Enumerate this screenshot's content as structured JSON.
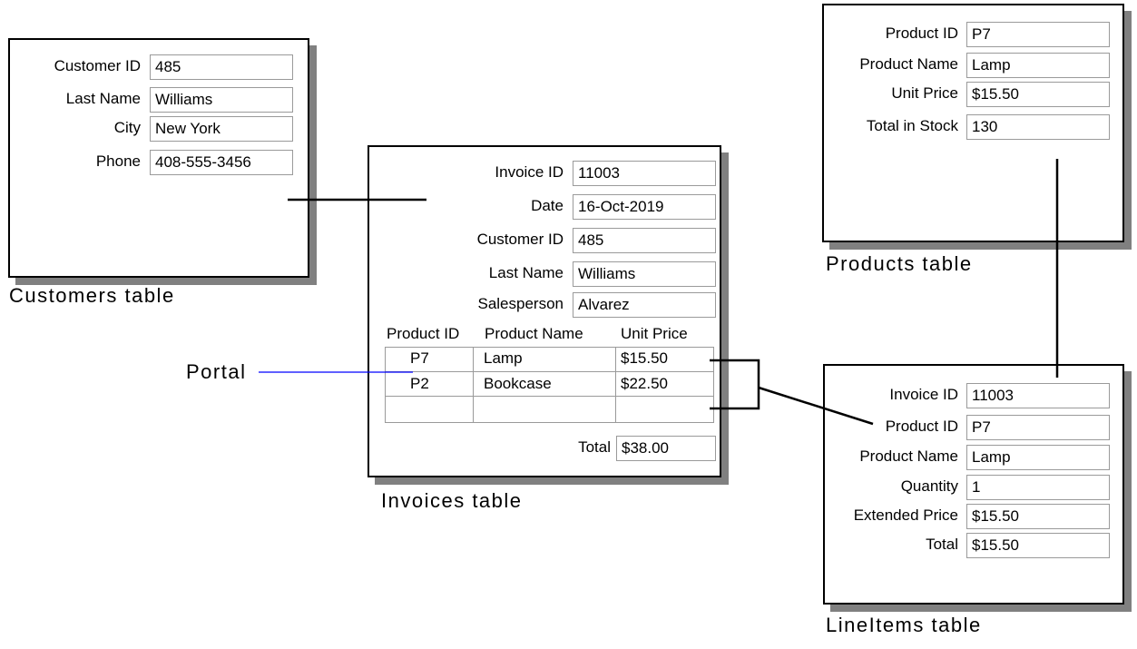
{
  "customers": {
    "caption": "Customers table",
    "fields": [
      {
        "label": "Customer ID",
        "value": "485"
      },
      {
        "label": "Last Name",
        "value": "Williams"
      },
      {
        "label": "City",
        "value": "New York"
      },
      {
        "label": "Phone",
        "value": "408-555-3456"
      }
    ]
  },
  "invoices": {
    "caption": "Invoices table",
    "fields": [
      {
        "label": "Invoice ID",
        "value": "11003"
      },
      {
        "label": "Date",
        "value": "16-Oct-2019"
      },
      {
        "label": "Customer ID",
        "value": "485"
      },
      {
        "label": "Last Name",
        "value": "Williams"
      },
      {
        "label": "Salesperson",
        "value": "Alvarez"
      }
    ],
    "portal": {
      "label": "Portal",
      "columns": [
        "Product ID",
        "Product Name",
        "Unit Price"
      ],
      "rows": [
        [
          "P7",
          "Lamp",
          "$15.50"
        ],
        [
          "P2",
          "Bookcase",
          "$22.50"
        ],
        [
          "",
          "",
          ""
        ]
      ]
    },
    "total": {
      "label": "Total",
      "value": "$38.00"
    }
  },
  "products": {
    "caption": "Products table",
    "fields": [
      {
        "label": "Product ID",
        "value": "P7"
      },
      {
        "label": "Product Name",
        "value": "Lamp"
      },
      {
        "label": "Unit Price",
        "value": "$15.50"
      },
      {
        "label": "Total in Stock",
        "value": "130"
      }
    ]
  },
  "lineitems": {
    "caption": "LineItems table",
    "fields": [
      {
        "label": "Invoice ID",
        "value": "11003"
      },
      {
        "label": "Product ID",
        "value": "P7"
      },
      {
        "label": "Product Name",
        "value": "Lamp"
      },
      {
        "label": "Quantity",
        "value": "1"
      },
      {
        "label": "Extended Price",
        "value": "$15.50"
      },
      {
        "label": "Total",
        "value": "$15.50"
      }
    ]
  },
  "colors": {
    "portal_line": "#0000ff",
    "shadow": "#808080"
  }
}
